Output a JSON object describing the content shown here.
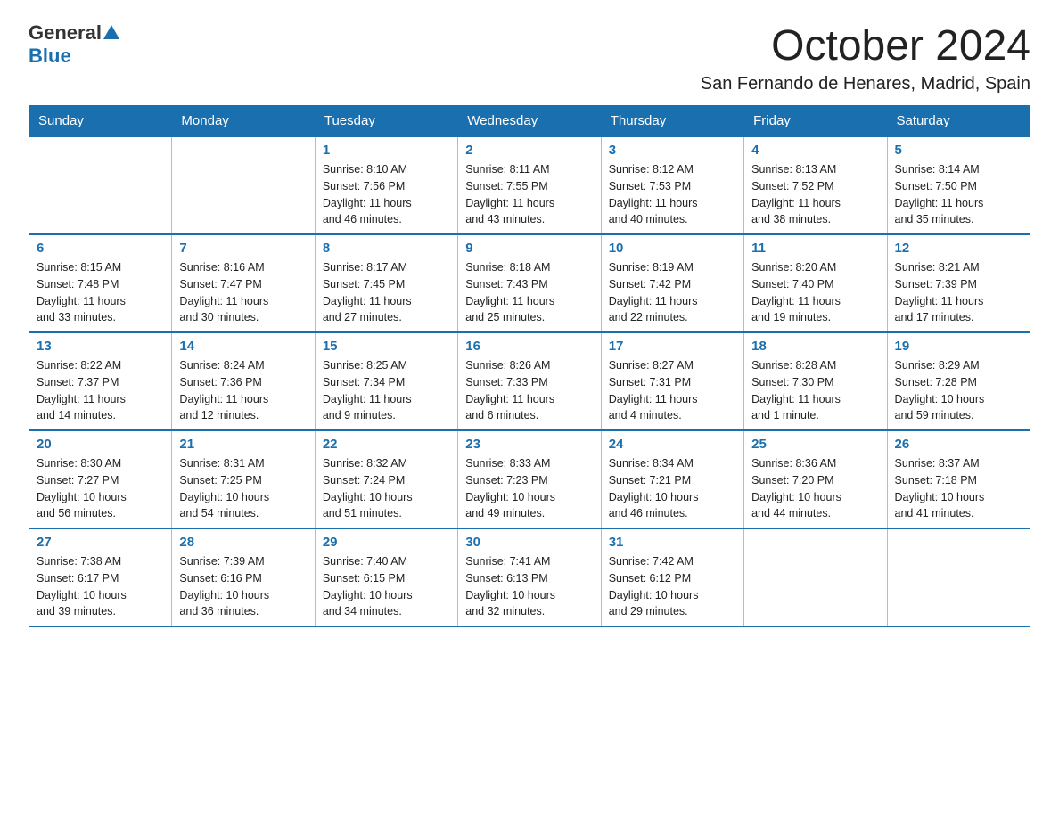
{
  "header": {
    "logo": {
      "part1": "General",
      "part2": "Blue"
    },
    "title": "October 2024",
    "subtitle": "San Fernando de Henares, Madrid, Spain"
  },
  "calendar": {
    "days_of_week": [
      "Sunday",
      "Monday",
      "Tuesday",
      "Wednesday",
      "Thursday",
      "Friday",
      "Saturday"
    ],
    "weeks": [
      [
        {
          "day": "",
          "info": ""
        },
        {
          "day": "",
          "info": ""
        },
        {
          "day": "1",
          "info": "Sunrise: 8:10 AM\nSunset: 7:56 PM\nDaylight: 11 hours\nand 46 minutes."
        },
        {
          "day": "2",
          "info": "Sunrise: 8:11 AM\nSunset: 7:55 PM\nDaylight: 11 hours\nand 43 minutes."
        },
        {
          "day": "3",
          "info": "Sunrise: 8:12 AM\nSunset: 7:53 PM\nDaylight: 11 hours\nand 40 minutes."
        },
        {
          "day": "4",
          "info": "Sunrise: 8:13 AM\nSunset: 7:52 PM\nDaylight: 11 hours\nand 38 minutes."
        },
        {
          "day": "5",
          "info": "Sunrise: 8:14 AM\nSunset: 7:50 PM\nDaylight: 11 hours\nand 35 minutes."
        }
      ],
      [
        {
          "day": "6",
          "info": "Sunrise: 8:15 AM\nSunset: 7:48 PM\nDaylight: 11 hours\nand 33 minutes."
        },
        {
          "day": "7",
          "info": "Sunrise: 8:16 AM\nSunset: 7:47 PM\nDaylight: 11 hours\nand 30 minutes."
        },
        {
          "day": "8",
          "info": "Sunrise: 8:17 AM\nSunset: 7:45 PM\nDaylight: 11 hours\nand 27 minutes."
        },
        {
          "day": "9",
          "info": "Sunrise: 8:18 AM\nSunset: 7:43 PM\nDaylight: 11 hours\nand 25 minutes."
        },
        {
          "day": "10",
          "info": "Sunrise: 8:19 AM\nSunset: 7:42 PM\nDaylight: 11 hours\nand 22 minutes."
        },
        {
          "day": "11",
          "info": "Sunrise: 8:20 AM\nSunset: 7:40 PM\nDaylight: 11 hours\nand 19 minutes."
        },
        {
          "day": "12",
          "info": "Sunrise: 8:21 AM\nSunset: 7:39 PM\nDaylight: 11 hours\nand 17 minutes."
        }
      ],
      [
        {
          "day": "13",
          "info": "Sunrise: 8:22 AM\nSunset: 7:37 PM\nDaylight: 11 hours\nand 14 minutes."
        },
        {
          "day": "14",
          "info": "Sunrise: 8:24 AM\nSunset: 7:36 PM\nDaylight: 11 hours\nand 12 minutes."
        },
        {
          "day": "15",
          "info": "Sunrise: 8:25 AM\nSunset: 7:34 PM\nDaylight: 11 hours\nand 9 minutes."
        },
        {
          "day": "16",
          "info": "Sunrise: 8:26 AM\nSunset: 7:33 PM\nDaylight: 11 hours\nand 6 minutes."
        },
        {
          "day": "17",
          "info": "Sunrise: 8:27 AM\nSunset: 7:31 PM\nDaylight: 11 hours\nand 4 minutes."
        },
        {
          "day": "18",
          "info": "Sunrise: 8:28 AM\nSunset: 7:30 PM\nDaylight: 11 hours\nand 1 minute."
        },
        {
          "day": "19",
          "info": "Sunrise: 8:29 AM\nSunset: 7:28 PM\nDaylight: 10 hours\nand 59 minutes."
        }
      ],
      [
        {
          "day": "20",
          "info": "Sunrise: 8:30 AM\nSunset: 7:27 PM\nDaylight: 10 hours\nand 56 minutes."
        },
        {
          "day": "21",
          "info": "Sunrise: 8:31 AM\nSunset: 7:25 PM\nDaylight: 10 hours\nand 54 minutes."
        },
        {
          "day": "22",
          "info": "Sunrise: 8:32 AM\nSunset: 7:24 PM\nDaylight: 10 hours\nand 51 minutes."
        },
        {
          "day": "23",
          "info": "Sunrise: 8:33 AM\nSunset: 7:23 PM\nDaylight: 10 hours\nand 49 minutes."
        },
        {
          "day": "24",
          "info": "Sunrise: 8:34 AM\nSunset: 7:21 PM\nDaylight: 10 hours\nand 46 minutes."
        },
        {
          "day": "25",
          "info": "Sunrise: 8:36 AM\nSunset: 7:20 PM\nDaylight: 10 hours\nand 44 minutes."
        },
        {
          "day": "26",
          "info": "Sunrise: 8:37 AM\nSunset: 7:18 PM\nDaylight: 10 hours\nand 41 minutes."
        }
      ],
      [
        {
          "day": "27",
          "info": "Sunrise: 7:38 AM\nSunset: 6:17 PM\nDaylight: 10 hours\nand 39 minutes."
        },
        {
          "day": "28",
          "info": "Sunrise: 7:39 AM\nSunset: 6:16 PM\nDaylight: 10 hours\nand 36 minutes."
        },
        {
          "day": "29",
          "info": "Sunrise: 7:40 AM\nSunset: 6:15 PM\nDaylight: 10 hours\nand 34 minutes."
        },
        {
          "day": "30",
          "info": "Sunrise: 7:41 AM\nSunset: 6:13 PM\nDaylight: 10 hours\nand 32 minutes."
        },
        {
          "day": "31",
          "info": "Sunrise: 7:42 AM\nSunset: 6:12 PM\nDaylight: 10 hours\nand 29 minutes."
        },
        {
          "day": "",
          "info": ""
        },
        {
          "day": "",
          "info": ""
        }
      ]
    ]
  }
}
